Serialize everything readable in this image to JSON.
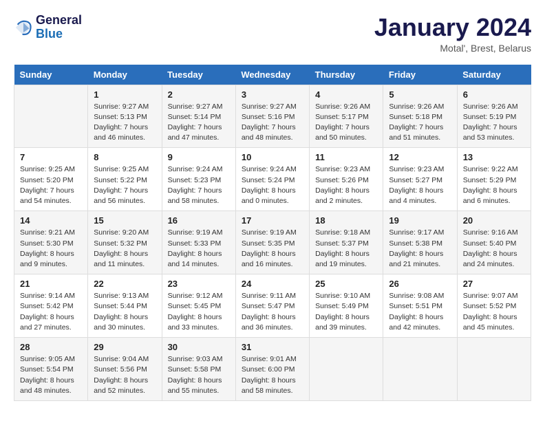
{
  "logo": {
    "line1": "General",
    "line2": "Blue"
  },
  "title": "January 2024",
  "location": "Motal', Brest, Belarus",
  "weekdays": [
    "Sunday",
    "Monday",
    "Tuesday",
    "Wednesday",
    "Thursday",
    "Friday",
    "Saturday"
  ],
  "weeks": [
    [
      {
        "day": "",
        "sunrise": "",
        "sunset": "",
        "daylight": ""
      },
      {
        "day": "1",
        "sunrise": "Sunrise: 9:27 AM",
        "sunset": "Sunset: 5:13 PM",
        "daylight": "Daylight: 7 hours and 46 minutes."
      },
      {
        "day": "2",
        "sunrise": "Sunrise: 9:27 AM",
        "sunset": "Sunset: 5:14 PM",
        "daylight": "Daylight: 7 hours and 47 minutes."
      },
      {
        "day": "3",
        "sunrise": "Sunrise: 9:27 AM",
        "sunset": "Sunset: 5:16 PM",
        "daylight": "Daylight: 7 hours and 48 minutes."
      },
      {
        "day": "4",
        "sunrise": "Sunrise: 9:26 AM",
        "sunset": "Sunset: 5:17 PM",
        "daylight": "Daylight: 7 hours and 50 minutes."
      },
      {
        "day": "5",
        "sunrise": "Sunrise: 9:26 AM",
        "sunset": "Sunset: 5:18 PM",
        "daylight": "Daylight: 7 hours and 51 minutes."
      },
      {
        "day": "6",
        "sunrise": "Sunrise: 9:26 AM",
        "sunset": "Sunset: 5:19 PM",
        "daylight": "Daylight: 7 hours and 53 minutes."
      }
    ],
    [
      {
        "day": "7",
        "sunrise": "Sunrise: 9:25 AM",
        "sunset": "Sunset: 5:20 PM",
        "daylight": "Daylight: 7 hours and 54 minutes."
      },
      {
        "day": "8",
        "sunrise": "Sunrise: 9:25 AM",
        "sunset": "Sunset: 5:22 PM",
        "daylight": "Daylight: 7 hours and 56 minutes."
      },
      {
        "day": "9",
        "sunrise": "Sunrise: 9:24 AM",
        "sunset": "Sunset: 5:23 PM",
        "daylight": "Daylight: 7 hours and 58 minutes."
      },
      {
        "day": "10",
        "sunrise": "Sunrise: 9:24 AM",
        "sunset": "Sunset: 5:24 PM",
        "daylight": "Daylight: 8 hours and 0 minutes."
      },
      {
        "day": "11",
        "sunrise": "Sunrise: 9:23 AM",
        "sunset": "Sunset: 5:26 PM",
        "daylight": "Daylight: 8 hours and 2 minutes."
      },
      {
        "day": "12",
        "sunrise": "Sunrise: 9:23 AM",
        "sunset": "Sunset: 5:27 PM",
        "daylight": "Daylight: 8 hours and 4 minutes."
      },
      {
        "day": "13",
        "sunrise": "Sunrise: 9:22 AM",
        "sunset": "Sunset: 5:29 PM",
        "daylight": "Daylight: 8 hours and 6 minutes."
      }
    ],
    [
      {
        "day": "14",
        "sunrise": "Sunrise: 9:21 AM",
        "sunset": "Sunset: 5:30 PM",
        "daylight": "Daylight: 8 hours and 9 minutes."
      },
      {
        "day": "15",
        "sunrise": "Sunrise: 9:20 AM",
        "sunset": "Sunset: 5:32 PM",
        "daylight": "Daylight: 8 hours and 11 minutes."
      },
      {
        "day": "16",
        "sunrise": "Sunrise: 9:19 AM",
        "sunset": "Sunset: 5:33 PM",
        "daylight": "Daylight: 8 hours and 14 minutes."
      },
      {
        "day": "17",
        "sunrise": "Sunrise: 9:19 AM",
        "sunset": "Sunset: 5:35 PM",
        "daylight": "Daylight: 8 hours and 16 minutes."
      },
      {
        "day": "18",
        "sunrise": "Sunrise: 9:18 AM",
        "sunset": "Sunset: 5:37 PM",
        "daylight": "Daylight: 8 hours and 19 minutes."
      },
      {
        "day": "19",
        "sunrise": "Sunrise: 9:17 AM",
        "sunset": "Sunset: 5:38 PM",
        "daylight": "Daylight: 8 hours and 21 minutes."
      },
      {
        "day": "20",
        "sunrise": "Sunrise: 9:16 AM",
        "sunset": "Sunset: 5:40 PM",
        "daylight": "Daylight: 8 hours and 24 minutes."
      }
    ],
    [
      {
        "day": "21",
        "sunrise": "Sunrise: 9:14 AM",
        "sunset": "Sunset: 5:42 PM",
        "daylight": "Daylight: 8 hours and 27 minutes."
      },
      {
        "day": "22",
        "sunrise": "Sunrise: 9:13 AM",
        "sunset": "Sunset: 5:44 PM",
        "daylight": "Daylight: 8 hours and 30 minutes."
      },
      {
        "day": "23",
        "sunrise": "Sunrise: 9:12 AM",
        "sunset": "Sunset: 5:45 PM",
        "daylight": "Daylight: 8 hours and 33 minutes."
      },
      {
        "day": "24",
        "sunrise": "Sunrise: 9:11 AM",
        "sunset": "Sunset: 5:47 PM",
        "daylight": "Daylight: 8 hours and 36 minutes."
      },
      {
        "day": "25",
        "sunrise": "Sunrise: 9:10 AM",
        "sunset": "Sunset: 5:49 PM",
        "daylight": "Daylight: 8 hours and 39 minutes."
      },
      {
        "day": "26",
        "sunrise": "Sunrise: 9:08 AM",
        "sunset": "Sunset: 5:51 PM",
        "daylight": "Daylight: 8 hours and 42 minutes."
      },
      {
        "day": "27",
        "sunrise": "Sunrise: 9:07 AM",
        "sunset": "Sunset: 5:52 PM",
        "daylight": "Daylight: 8 hours and 45 minutes."
      }
    ],
    [
      {
        "day": "28",
        "sunrise": "Sunrise: 9:05 AM",
        "sunset": "Sunset: 5:54 PM",
        "daylight": "Daylight: 8 hours and 48 minutes."
      },
      {
        "day": "29",
        "sunrise": "Sunrise: 9:04 AM",
        "sunset": "Sunset: 5:56 PM",
        "daylight": "Daylight: 8 hours and 52 minutes."
      },
      {
        "day": "30",
        "sunrise": "Sunrise: 9:03 AM",
        "sunset": "Sunset: 5:58 PM",
        "daylight": "Daylight: 8 hours and 55 minutes."
      },
      {
        "day": "31",
        "sunrise": "Sunrise: 9:01 AM",
        "sunset": "Sunset: 6:00 PM",
        "daylight": "Daylight: 8 hours and 58 minutes."
      },
      {
        "day": "",
        "sunrise": "",
        "sunset": "",
        "daylight": ""
      },
      {
        "day": "",
        "sunrise": "",
        "sunset": "",
        "daylight": ""
      },
      {
        "day": "",
        "sunrise": "",
        "sunset": "",
        "daylight": ""
      }
    ]
  ]
}
